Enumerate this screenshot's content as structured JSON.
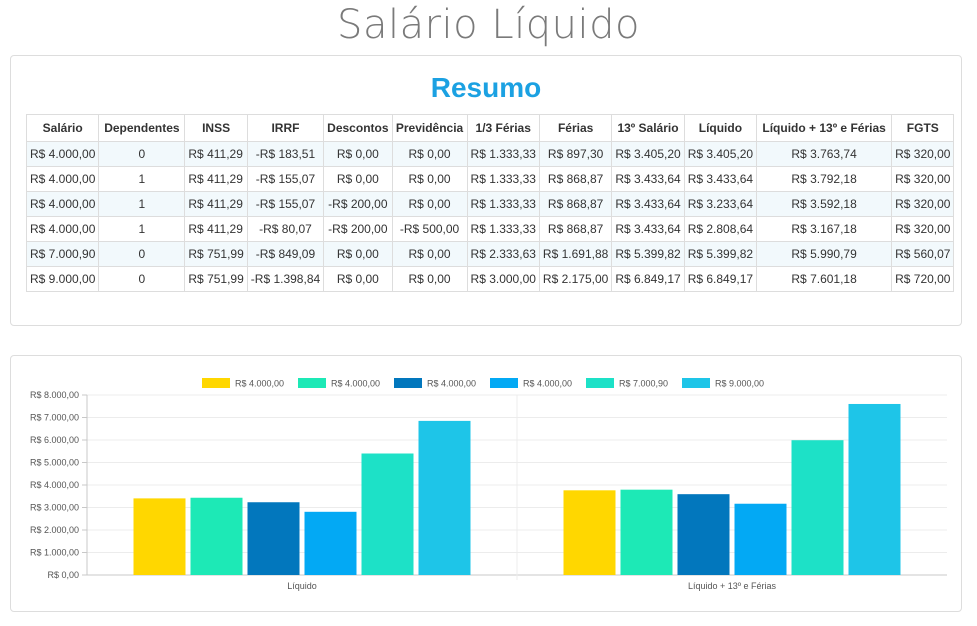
{
  "page": {
    "title": "Salário Líquido"
  },
  "summary": {
    "title": "Resumo",
    "columns": [
      "Salário",
      "Dependentes",
      "INSS",
      "IRRF",
      "Descontos",
      "Previdência",
      "1/3 Férias",
      "Férias",
      "13º Salário",
      "Líquido",
      "Líquido + 13º e Férias",
      "FGTS"
    ],
    "rows": [
      [
        "R$ 4.000,00",
        "0",
        "R$ 411,29",
        "-R$ 183,51",
        "R$ 0,00",
        "R$ 0,00",
        "R$ 1.333,33",
        "R$ 897,30",
        "R$ 3.405,20",
        "R$ 3.405,20",
        "R$ 3.763,74",
        "R$ 320,00"
      ],
      [
        "R$ 4.000,00",
        "1",
        "R$ 411,29",
        "-R$ 155,07",
        "R$ 0,00",
        "R$ 0,00",
        "R$ 1.333,33",
        "R$ 868,87",
        "R$ 3.433,64",
        "R$ 3.433,64",
        "R$ 3.792,18",
        "R$ 320,00"
      ],
      [
        "R$ 4.000,00",
        "1",
        "R$ 411,29",
        "-R$ 155,07",
        "-R$ 200,00",
        "R$ 0,00",
        "R$ 1.333,33",
        "R$ 868,87",
        "R$ 3.433,64",
        "R$ 3.233,64",
        "R$ 3.592,18",
        "R$ 320,00"
      ],
      [
        "R$ 4.000,00",
        "1",
        "R$ 411,29",
        "-R$ 80,07",
        "-R$ 200,00",
        "-R$ 500,00",
        "R$ 1.333,33",
        "R$ 868,87",
        "R$ 3.433,64",
        "R$ 2.808,64",
        "R$ 3.167,18",
        "R$ 320,00"
      ],
      [
        "R$ 7.000,90",
        "0",
        "R$ 751,99",
        "-R$ 849,09",
        "R$ 0,00",
        "R$ 0,00",
        "R$ 2.333,63",
        "R$ 1.691,88",
        "R$ 5.399,82",
        "R$ 5.399,82",
        "R$ 5.990,79",
        "R$ 560,07"
      ],
      [
        "R$ 9.000,00",
        "0",
        "R$ 751,99",
        "-R$ 1.398,84",
        "R$ 0,00",
        "R$ 0,00",
        "R$ 3.000,00",
        "R$ 2.175,00",
        "R$ 6.849,17",
        "R$ 6.849,17",
        "R$ 7.601,18",
        "R$ 720,00"
      ]
    ]
  },
  "chart_data": {
    "type": "bar",
    "categories": [
      "Líquido",
      "Líquido + 13º e Férias"
    ],
    "series": [
      {
        "name": "R$ 4.000,00",
        "color": "#ffd700",
        "values": [
          3405.2,
          3763.74
        ]
      },
      {
        "name": "R$ 4.000,00",
        "color": "#1de9b6",
        "values": [
          3433.64,
          3792.18
        ]
      },
      {
        "name": "R$ 4.000,00",
        "color": "#0277bd",
        "values": [
          3233.64,
          3592.18
        ]
      },
      {
        "name": "R$ 4.000,00",
        "color": "#03a9f4",
        "values": [
          2808.64,
          3167.18
        ]
      },
      {
        "name": "R$ 7.000,90",
        "color": "#1de1c7",
        "values": [
          5399.82,
          5990.79
        ]
      },
      {
        "name": "R$ 9.000,00",
        "color": "#1ec5e8",
        "values": [
          6849.17,
          7601.18
        ]
      }
    ],
    "ylim": [
      0,
      8000
    ],
    "yticks": [
      "R$ 0,00",
      "R$ 1.000,00",
      "R$ 2.000,00",
      "R$ 3.000,00",
      "R$ 4.000,00",
      "R$ 5.000,00",
      "R$ 6.000,00",
      "R$ 7.000,00",
      "R$ 8.000,00"
    ],
    "legend_position": "top",
    "grid": true
  }
}
